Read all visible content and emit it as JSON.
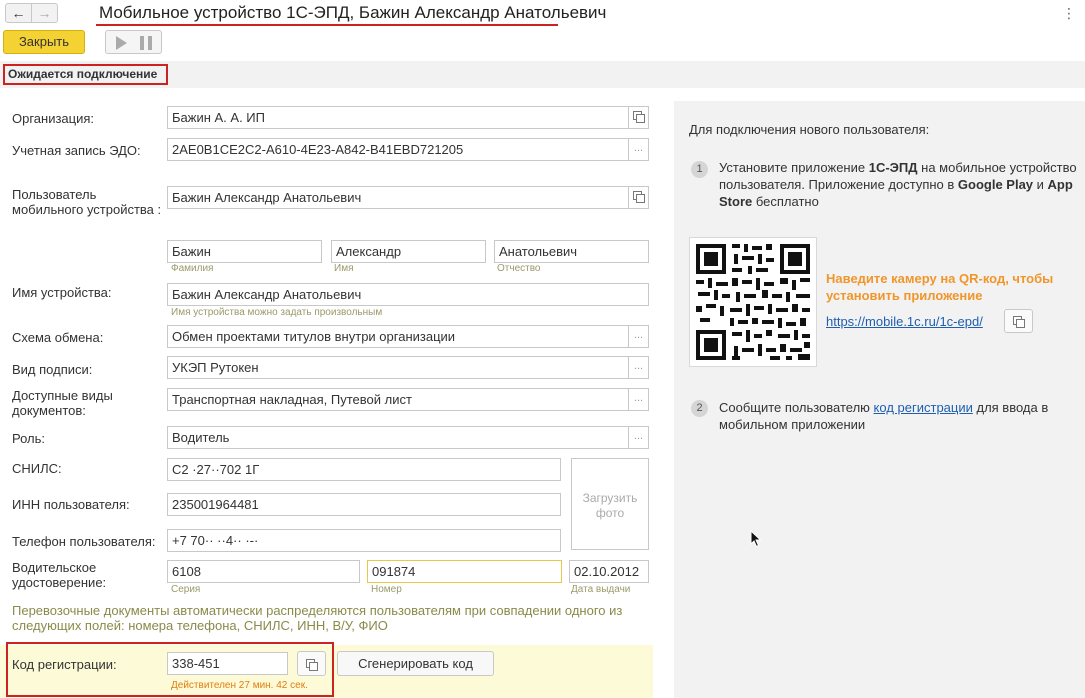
{
  "window": {
    "title": "Мобильное устройство 1С-ЭПД, Бажин Александр Анатольевич",
    "back_glyph": "←",
    "forward_glyph": "→",
    "more_glyph": "⋮"
  },
  "toolbar": {
    "close_label": "Закрыть"
  },
  "status": {
    "text": "Ожидается подключение"
  },
  "form": {
    "organization": {
      "label": "Организация:",
      "value": "Бажин А. А. ИП"
    },
    "edo_account": {
      "label": "Учетная запись ЭДО:",
      "value": "2AE0B1CE2C2-A610-4E23-A842-B41EBD721205"
    },
    "mobile_user": {
      "label": "Пользователь мобильного устройства :",
      "value": "Бажин Александр Анатольевич",
      "last_name": {
        "value": "Бажин",
        "caption": "Фамилия"
      },
      "first_name": {
        "value": "Александр",
        "caption": "Имя"
      },
      "patronymic": {
        "value": "Анатольевич",
        "caption": "Отчество"
      }
    },
    "device_name": {
      "label": "Имя устройства:",
      "value": "Бажин Александр Анатольевич",
      "hint": "Имя устройства можно задать произвольным"
    },
    "exchange_scheme": {
      "label": "Схема обмена:",
      "value": "Обмен проектами титулов внутри организации"
    },
    "signature_type": {
      "label": "Вид подписи:",
      "value": "УКЭП Рутокен"
    },
    "document_types": {
      "label": "Доступные виды документов:",
      "value": "Транспортная накладная, Путевой лист"
    },
    "role": {
      "label": "Роль:",
      "value": "Водитель"
    },
    "snils": {
      "label": "СНИЛС:",
      "value": "C2 ·27··702 1Г"
    },
    "inn": {
      "label": "ИНН пользователя:",
      "value": "235001964481"
    },
    "phone": {
      "label": "Телефон пользователя:",
      "value": "+7 70·· ··4·· ·-·"
    },
    "photo_label": "Загрузить фото",
    "license": {
      "label": "Водительское удостоверение:",
      "series": {
        "value": "6108",
        "caption": "Серия"
      },
      "number": {
        "value": "091874",
        "caption": "Номер"
      },
      "date": {
        "value": "02.10.2012",
        "caption": "Дата выдачи"
      }
    },
    "note": "Перевозочные документы автоматически распределяются пользователям при совпадении одного из следующих полей: номера телефона, СНИЛС, ИНН, В/У, ФИО",
    "registration": {
      "label": "Код регистрации:",
      "value": "338-451",
      "validity": "Действителен 27 мин. 42 сек.",
      "generate_label": "Сгенерировать код"
    },
    "choice_glyph": "..."
  },
  "help": {
    "heading": "Для подключения нового пользователя:",
    "step1": {
      "num": "1",
      "part1": "Установите приложение ",
      "app": "1С-ЭПД",
      "part2": " на мобильное устройство пользователя. Приложение доступно в ",
      "store1": "Google Play",
      "and": " и ",
      "store2": "App Store",
      "part3": " бесплатно"
    },
    "qr_hint": "Наведите камеру на QR-код, чтобы установить приложение",
    "qr_link": "https://mobile.1c.ru/1c-epd/",
    "step2": {
      "num": "2",
      "part1": "Сообщите пользователю ",
      "link": "код регистрации",
      "part2": " для ввода в мобильном приложении"
    }
  }
}
